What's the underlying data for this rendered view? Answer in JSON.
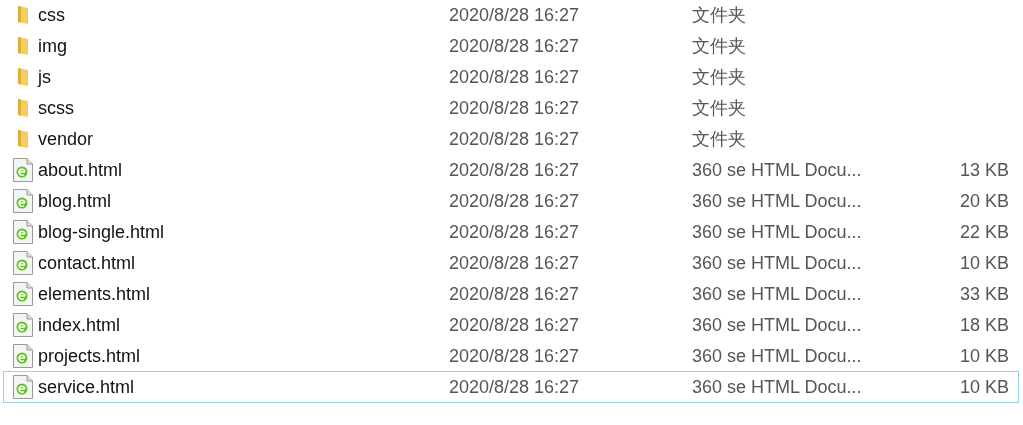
{
  "files": [
    {
      "kind": "folder",
      "name": "css",
      "modified": "2020/8/28 16:27",
      "type": "文件夹",
      "focused": false
    },
    {
      "kind": "folder",
      "name": "img",
      "modified": "2020/8/28 16:27",
      "type": "文件夹",
      "focused": false
    },
    {
      "kind": "folder",
      "name": "js",
      "modified": "2020/8/28 16:27",
      "type": "文件夹",
      "focused": false
    },
    {
      "kind": "folder",
      "name": "scss",
      "modified": "2020/8/28 16:27",
      "type": "文件夹",
      "focused": false
    },
    {
      "kind": "folder",
      "name": "vendor",
      "modified": "2020/8/28 16:27",
      "type": "文件夹",
      "focused": false
    },
    {
      "kind": "html",
      "name": "about.html",
      "modified": "2020/8/28 16:27",
      "type": "360 se HTML Docu...",
      "size": "13 KB",
      "focused": false
    },
    {
      "kind": "html",
      "name": "blog.html",
      "modified": "2020/8/28 16:27",
      "type": "360 se HTML Docu...",
      "size": "20 KB",
      "focused": false
    },
    {
      "kind": "html",
      "name": "blog-single.html",
      "modified": "2020/8/28 16:27",
      "type": "360 se HTML Docu...",
      "size": "22 KB",
      "focused": false
    },
    {
      "kind": "html",
      "name": "contact.html",
      "modified": "2020/8/28 16:27",
      "type": "360 se HTML Docu...",
      "size": "10 KB",
      "focused": false
    },
    {
      "kind": "html",
      "name": "elements.html",
      "modified": "2020/8/28 16:27",
      "type": "360 se HTML Docu...",
      "size": "33 KB",
      "focused": false
    },
    {
      "kind": "html",
      "name": "index.html",
      "modified": "2020/8/28 16:27",
      "type": "360 se HTML Docu...",
      "size": "18 KB",
      "focused": false
    },
    {
      "kind": "html",
      "name": "projects.html",
      "modified": "2020/8/28 16:27",
      "type": "360 se HTML Docu...",
      "size": "10 KB",
      "focused": false
    },
    {
      "kind": "html",
      "name": "service.html",
      "modified": "2020/8/28 16:27",
      "type": "360 se HTML Docu...",
      "size": "10 KB",
      "focused": true
    }
  ]
}
